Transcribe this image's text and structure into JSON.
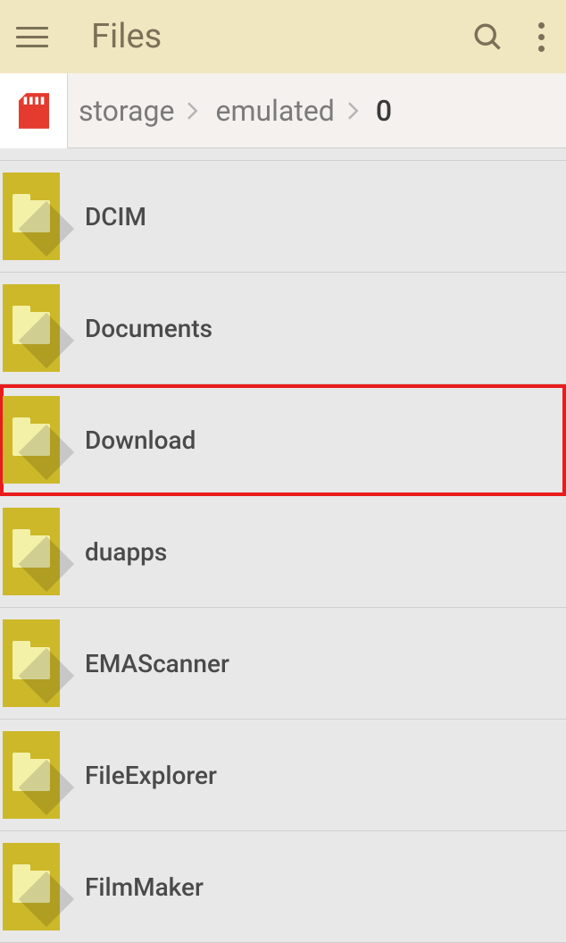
{
  "header": {
    "title": "Files"
  },
  "breadcrumb": {
    "segments": [
      "storage",
      "emulated"
    ],
    "current": "0"
  },
  "folders": [
    {
      "name": "DCIM",
      "highlighted": false
    },
    {
      "name": "Documents",
      "highlighted": false
    },
    {
      "name": "Download",
      "highlighted": true
    },
    {
      "name": "duapps",
      "highlighted": false
    },
    {
      "name": "EMAScanner",
      "highlighted": false
    },
    {
      "name": "FileExplorer",
      "highlighted": false
    },
    {
      "name": "FilmMaker",
      "highlighted": false
    }
  ]
}
